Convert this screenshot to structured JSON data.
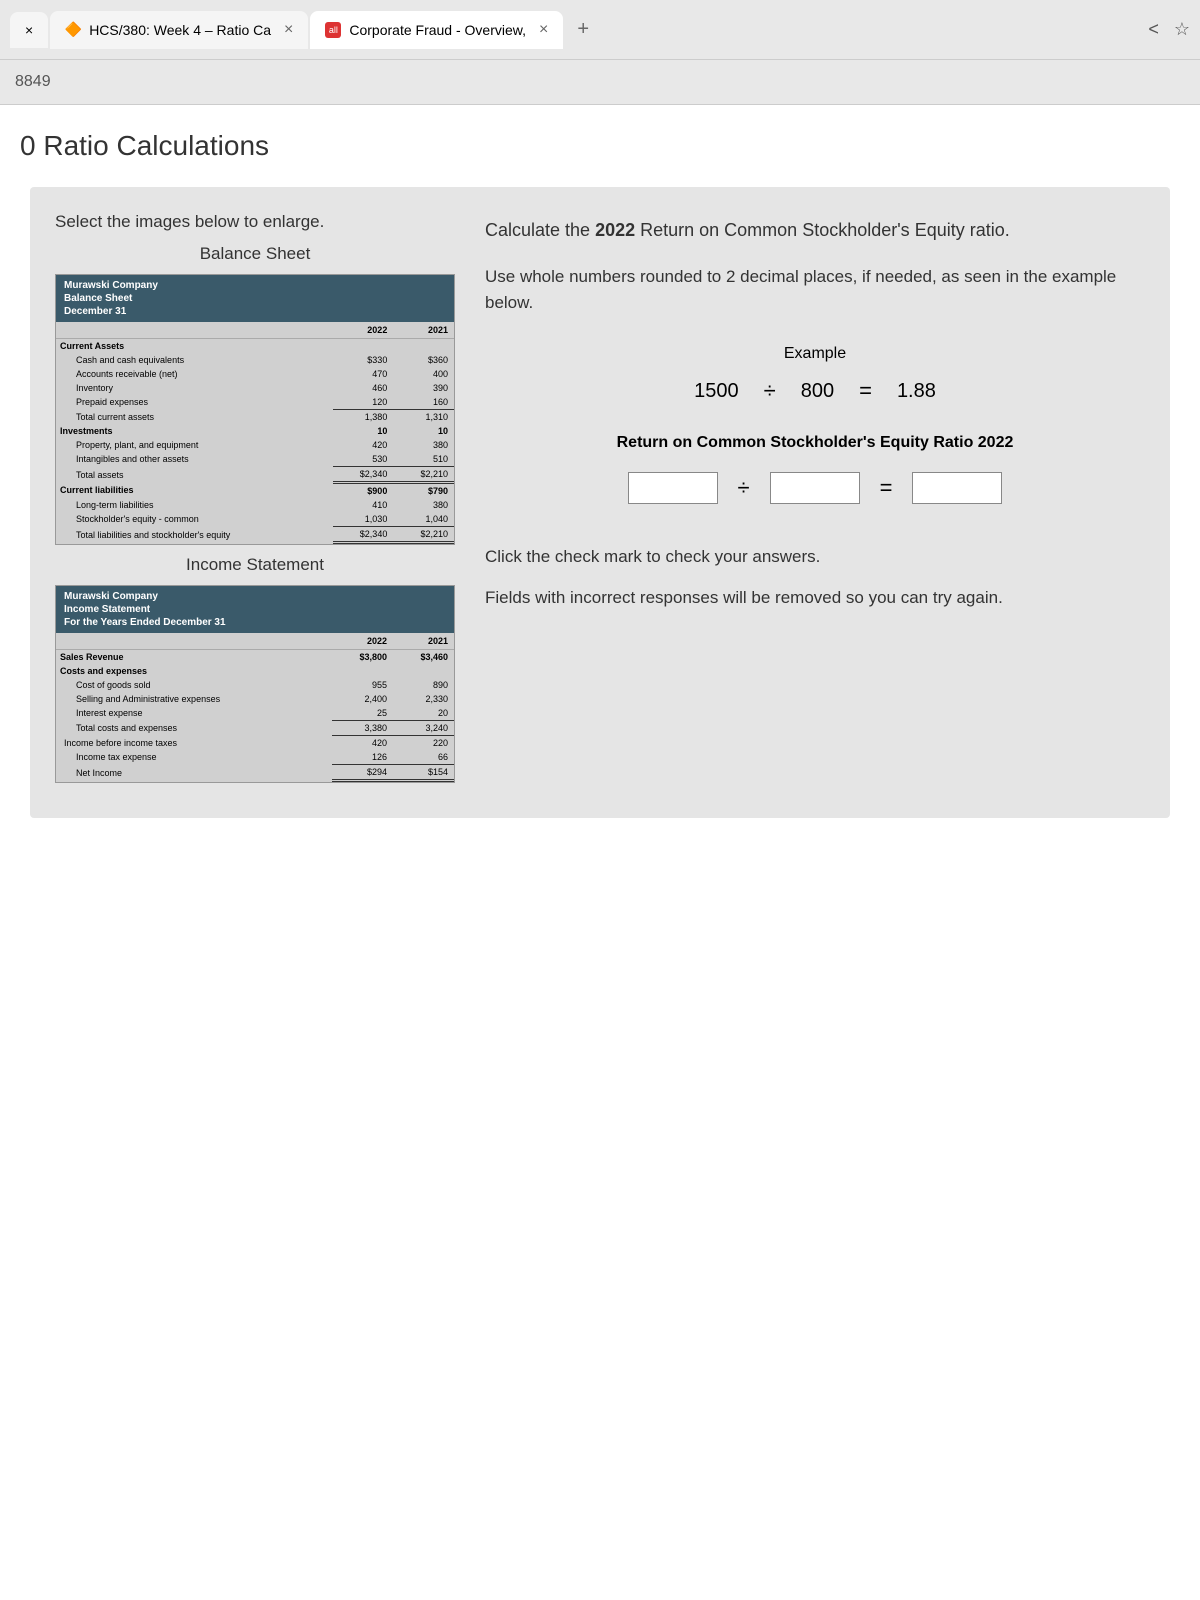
{
  "tabs": [
    {
      "label": "",
      "icon": "×"
    },
    {
      "label": "HCS/380: Week 4 – Ratio Ca",
      "close": "×"
    },
    {
      "label": "Corporate Fraud - Overview,",
      "close": "×"
    }
  ],
  "new_tab": "+",
  "url_fragment": "8849",
  "page_title": "0 Ratio Calculations",
  "instruction": "Select the images below to enlarge.",
  "balance_sheet_title": "Balance Sheet",
  "income_statement_title": "Income Statement",
  "bs": {
    "company": "Murawski Company",
    "doc": "Balance Sheet",
    "date": "December 31",
    "cols": [
      "2022",
      "2021"
    ],
    "sections": {
      "current_assets": "Current Assets",
      "investments": "Investments",
      "current_liabilities": "Current liabilities"
    },
    "rows": {
      "cash": {
        "label": "Cash and cash equivalents",
        "v22": "$330",
        "v21": "$360"
      },
      "ar": {
        "label": "Accounts receivable (net)",
        "v22": "470",
        "v21": "400"
      },
      "inv": {
        "label": "Inventory",
        "v22": "460",
        "v21": "390"
      },
      "prepaid": {
        "label": "Prepaid expenses",
        "v22": "120",
        "v21": "160"
      },
      "tca": {
        "label": "Total current assets",
        "v22": "1,380",
        "v21": "1,310"
      },
      "inv_amt": {
        "label": "",
        "v22": "10",
        "v21": "10"
      },
      "ppe": {
        "label": "Property, plant, and equipment",
        "v22": "420",
        "v21": "380"
      },
      "intang": {
        "label": "Intangibles and other assets",
        "v22": "530",
        "v21": "510"
      },
      "ta": {
        "label": "Total assets",
        "v22": "$2,340",
        "v21": "$2,210"
      },
      "cl_amt": {
        "label": "",
        "v22": "$900",
        "v21": "$790"
      },
      "ltl": {
        "label": "Long-term liabilities",
        "v22": "410",
        "v21": "380"
      },
      "se": {
        "label": "Stockholder's equity - common",
        "v22": "1,030",
        "v21": "1,040"
      },
      "tlse": {
        "label": "Total liabilities and stockholder's equity",
        "v22": "$2,340",
        "v21": "$2,210"
      }
    }
  },
  "is": {
    "company": "Murawski Company",
    "doc": "Income Statement",
    "date": "For the Years Ended December 31",
    "cols": [
      "2022",
      "2021"
    ],
    "rows": {
      "sales": {
        "label": "Sales Revenue",
        "v22": "$3,800",
        "v21": "$3,460"
      },
      "costs_head": "Costs and expenses",
      "cogs": {
        "label": "Cost of goods sold",
        "v22": "955",
        "v21": "890"
      },
      "sga": {
        "label": "Selling and Administrative expenses",
        "v22": "2,400",
        "v21": "2,330"
      },
      "int": {
        "label": "Interest expense",
        "v22": "25",
        "v21": "20"
      },
      "tce": {
        "label": "Total costs and expenses",
        "v22": "3,380",
        "v21": "3,240"
      },
      "ibt": {
        "label": "Income before income taxes",
        "v22": "420",
        "v21": "220"
      },
      "tax": {
        "label": "Income tax expense",
        "v22": "126",
        "v21": "66"
      },
      "ni": {
        "label": "Net Income",
        "v22": "$294",
        "v21": "$154"
      }
    }
  },
  "question": {
    "line1a": "Calculate the ",
    "line1b": "2022",
    "line1c": " Return on Common Stockholder's Equity ratio."
  },
  "hint": "Use whole numbers rounded to 2 decimal places, if needed, as seen in the example below.",
  "example_label": "Example",
  "example": {
    "a": "1500",
    "op1": "÷",
    "b": "800",
    "op2": "=",
    "c": "1.88"
  },
  "ratio_title": "Return on Common Stockholder's Equity Ratio 2022",
  "input_ops": {
    "div": "÷",
    "eq": "="
  },
  "check_text": "Click the check mark to check your answers.",
  "check_text2": "Fields with incorrect responses will be removed so you can try again."
}
